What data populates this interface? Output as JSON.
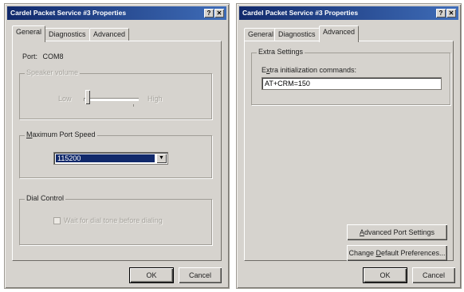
{
  "dialogs": [
    {
      "title": "Cardel Packet Service #3 Properties",
      "close_glyph": "?",
      "help_glyph": "?",
      "tabs": [
        "General",
        "Diagnostics",
        "Advanced"
      ],
      "active_tab": "General",
      "port_label": "Port:",
      "port_value": "COM8",
      "speaker_volume": {
        "label": "Speaker volume",
        "low": "Low",
        "high": "High"
      },
      "max_port_speed": {
        "label": "Maximum Port Speed",
        "value": "115200"
      },
      "dial_control": {
        "label": "Dial Control",
        "checkbox_label": "Wait for dial tone before dialing"
      },
      "ok_label": "OK",
      "cancel_label": "Cancel"
    },
    {
      "title": "Cardel Packet Service #3 Properties",
      "close_glyph": "?",
      "help_glyph": "?",
      "tabs": [
        "General",
        "Diagnostics",
        "Advanced"
      ],
      "active_tab": "Advanced",
      "extra_settings": {
        "label": "Extra Settings",
        "field_label": "Extra initialization commands:",
        "field_value": "AT+CRM=150"
      },
      "advanced_port_settings_label": "Advanced Port Settings",
      "change_default_preferences_label": "Change Default Preferences...",
      "ok_label": "OK",
      "cancel_label": "Cancel"
    }
  ]
}
